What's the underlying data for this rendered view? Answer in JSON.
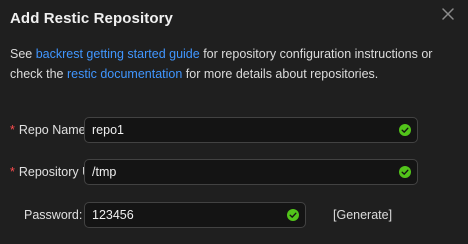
{
  "modal": {
    "title": "Add Restic Repository",
    "close_icon": "close-icon"
  },
  "intro": {
    "text_1": "See ",
    "link_1": "backrest getting started guide",
    "text_2": " for repository configuration instructions or check the ",
    "link_2": "restic documentation",
    "text_3": " for more details about repositories."
  },
  "form": {
    "repo_name": {
      "required_mark": "*",
      "label": "Repo Name",
      "value": "repo1",
      "status_icon": "check-circle-icon"
    },
    "repository_uri": {
      "required_mark": "*",
      "label": "Repository URI",
      "value": "/tmp",
      "status_icon": "check-circle-icon"
    },
    "password": {
      "label": "Password",
      "colon": ":",
      "value": "123456",
      "status_icon": "check-circle-icon",
      "generate_label": "[Generate]"
    }
  },
  "colors": {
    "background": "#1f1f1f",
    "input_background": "#141414",
    "input_border": "#424242",
    "link": "#4096ff",
    "required": "#ff4d4f",
    "success": "#52c41a"
  }
}
